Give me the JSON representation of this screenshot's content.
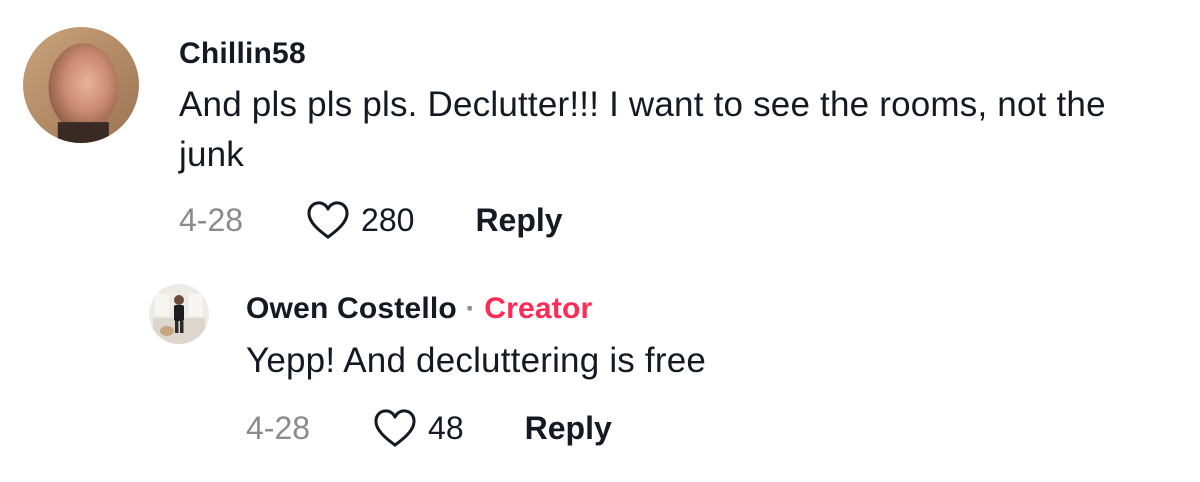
{
  "comments": [
    {
      "username": "Chillin58",
      "text": "And pls pls pls. Declutter!!! I want to see the rooms, not the junk",
      "date": "4-28",
      "likes": "280",
      "reply_label": "Reply",
      "avatar_icon": "profile-photo"
    }
  ],
  "replies": [
    {
      "username": "Owen Costello",
      "separator": "·",
      "badge": "Creator",
      "text": "Yepp! And decluttering is free",
      "date": "4-28",
      "likes": "48",
      "reply_label": "Reply",
      "avatar_icon": "profile-photo"
    }
  ],
  "colors": {
    "text": "#161823",
    "muted": "#8a8b91",
    "creator_badge": "#fe2c55"
  },
  "icons": {
    "like": "heart-outline-icon"
  }
}
